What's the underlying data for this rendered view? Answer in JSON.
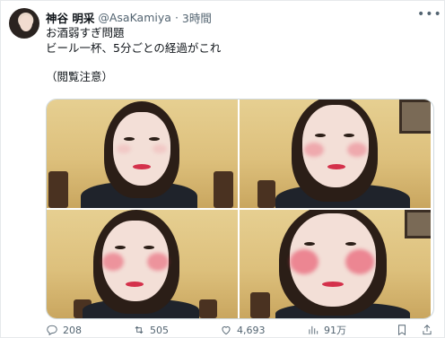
{
  "author": {
    "display_name": "神谷 明采",
    "handle": "@AsaKamiya",
    "separator": "·",
    "time": "3時間"
  },
  "tweet": {
    "lines": [
      "お酒弱すぎ問題",
      "ビール一杯、5分ごとの経過がこれ",
      "（閲覧注意）"
    ]
  },
  "media": {
    "photos": [
      {
        "flush_level": 0.15
      },
      {
        "flush_level": 0.5
      },
      {
        "flush_level": 0.75
      },
      {
        "flush_level": 1.0
      }
    ]
  },
  "actions": {
    "replies": "208",
    "retweets": "505",
    "likes": "4,693",
    "views": "91万"
  },
  "icons": {
    "more": "more-horizontal-icon",
    "reply": "reply-icon",
    "retweet": "retweet-icon",
    "like": "heart-icon",
    "views": "bar-chart-icon",
    "bookmark": "bookmark-icon",
    "share": "share-icon"
  },
  "colors": {
    "text": "#0f1419",
    "secondary": "#536471",
    "border": "#cfd9de"
  }
}
